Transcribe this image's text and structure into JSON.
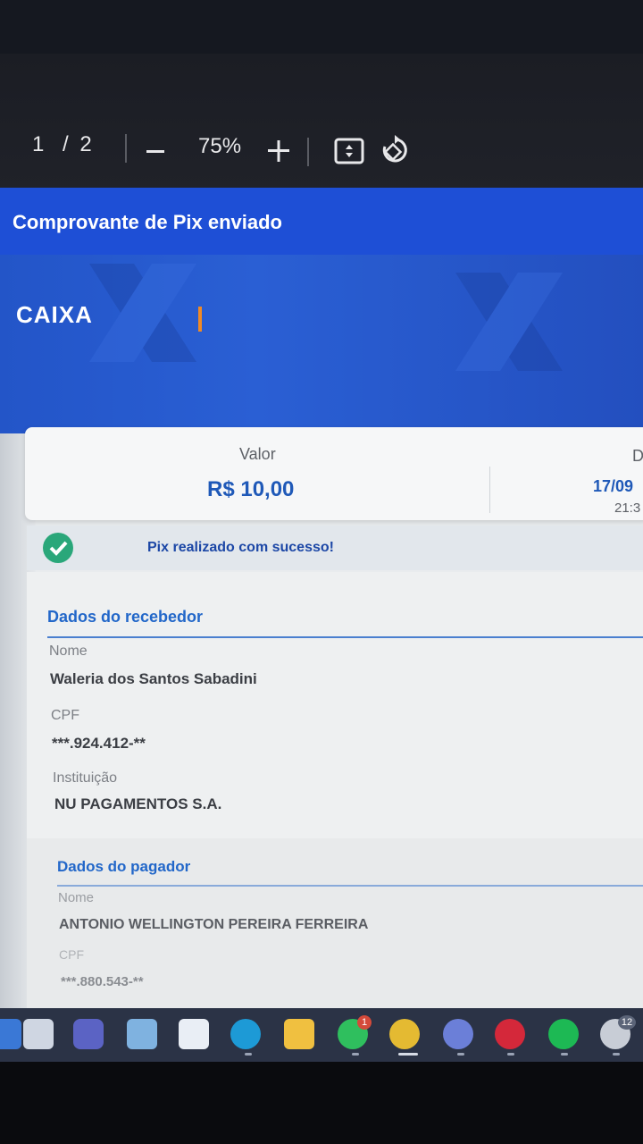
{
  "viewer": {
    "page_current": "1",
    "page_separator": "/",
    "page_total": "2",
    "zoom": "75%"
  },
  "document": {
    "title": "Comprovante de Pix enviado",
    "logo_text": "CAIXA",
    "value_label": "Valor",
    "value_amount": "R$ 10,00",
    "date_label": "D",
    "date_value": "17/09",
    "time_value": "21:3",
    "success_message": "Pix realizado com sucesso!",
    "receiver": {
      "section_title": "Dados do recebedor",
      "name_label": "Nome",
      "name_value": "Waleria dos Santos Sabadini",
      "cpf_label": "CPF",
      "cpf_value": "***.924.412-**",
      "institution_label": "Instituição",
      "institution_value": "NU PAGAMENTOS S.A."
    },
    "payer": {
      "section_title": "Dados do pagador",
      "name_label": "Nome",
      "name_value": "ANTONIO WELLINGTON PEREIRA FERREIRA",
      "cpf_label": "CPF",
      "cpf_value": "***.880.543-**"
    }
  },
  "taskbar": {
    "whatsapp_badge": "1",
    "tray_badge": "12",
    "icons": [
      "windows-icon",
      "search-icon",
      "teams-icon",
      "notepad-icon",
      "store-icon",
      "edge-icon",
      "file-explorer-icon",
      "whatsapp-icon",
      "chrome-icon",
      "discord-icon",
      "opera-icon",
      "spotify-icon",
      "steam-icon"
    ]
  },
  "colors": {
    "brand_blue": "#1e4fd6",
    "value_blue": "#1f59b8",
    "success_green": "#2aa77a",
    "section_blue": "#2267c9"
  }
}
